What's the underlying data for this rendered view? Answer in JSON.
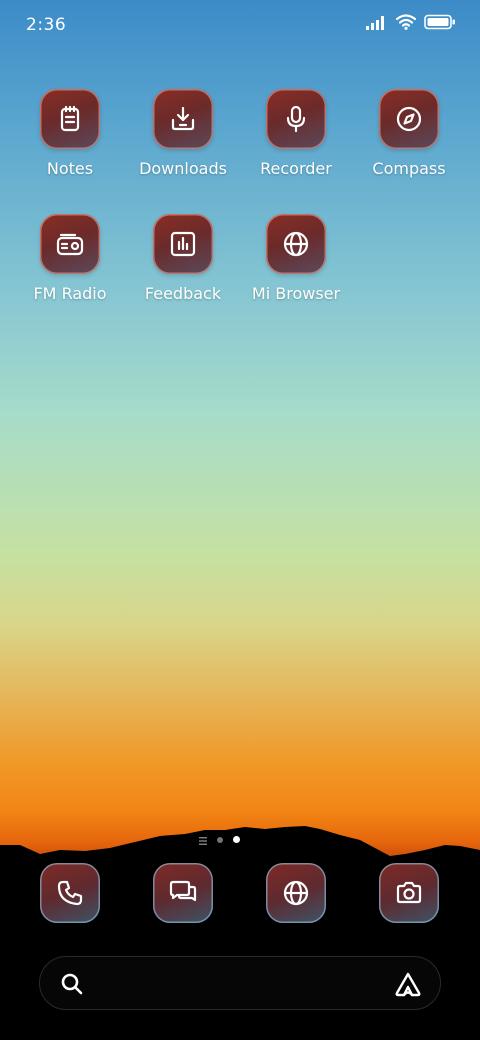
{
  "status_bar": {
    "time": "2:36",
    "icons": [
      "signal-icon",
      "wifi-icon",
      "battery-icon"
    ]
  },
  "apps": [
    {
      "label": "Notes",
      "icon": "notes-icon"
    },
    {
      "label": "Downloads",
      "icon": "download-icon"
    },
    {
      "label": "Recorder",
      "icon": "microphone-icon"
    },
    {
      "label": "Compass",
      "icon": "compass-icon"
    },
    {
      "label": "FM Radio",
      "icon": "radio-icon"
    },
    {
      "label": "Feedback",
      "icon": "feedback-chart-icon"
    },
    {
      "label": "Mi Browser",
      "icon": "globe-icon"
    }
  ],
  "page_indicator": {
    "pages": 3,
    "active_index": 2
  },
  "dock": [
    {
      "icon": "phone-icon"
    },
    {
      "icon": "messages-icon"
    },
    {
      "icon": "globe-icon"
    },
    {
      "icon": "camera-icon"
    }
  ],
  "search_bar": {
    "left_icon": "search-icon",
    "right_icon": "assistant-icon"
  },
  "colors": {
    "icon_bg": "#6b2a2a",
    "sky_top": "#3c8bc8",
    "horizon": "#f28614",
    "ground": "#000000"
  }
}
